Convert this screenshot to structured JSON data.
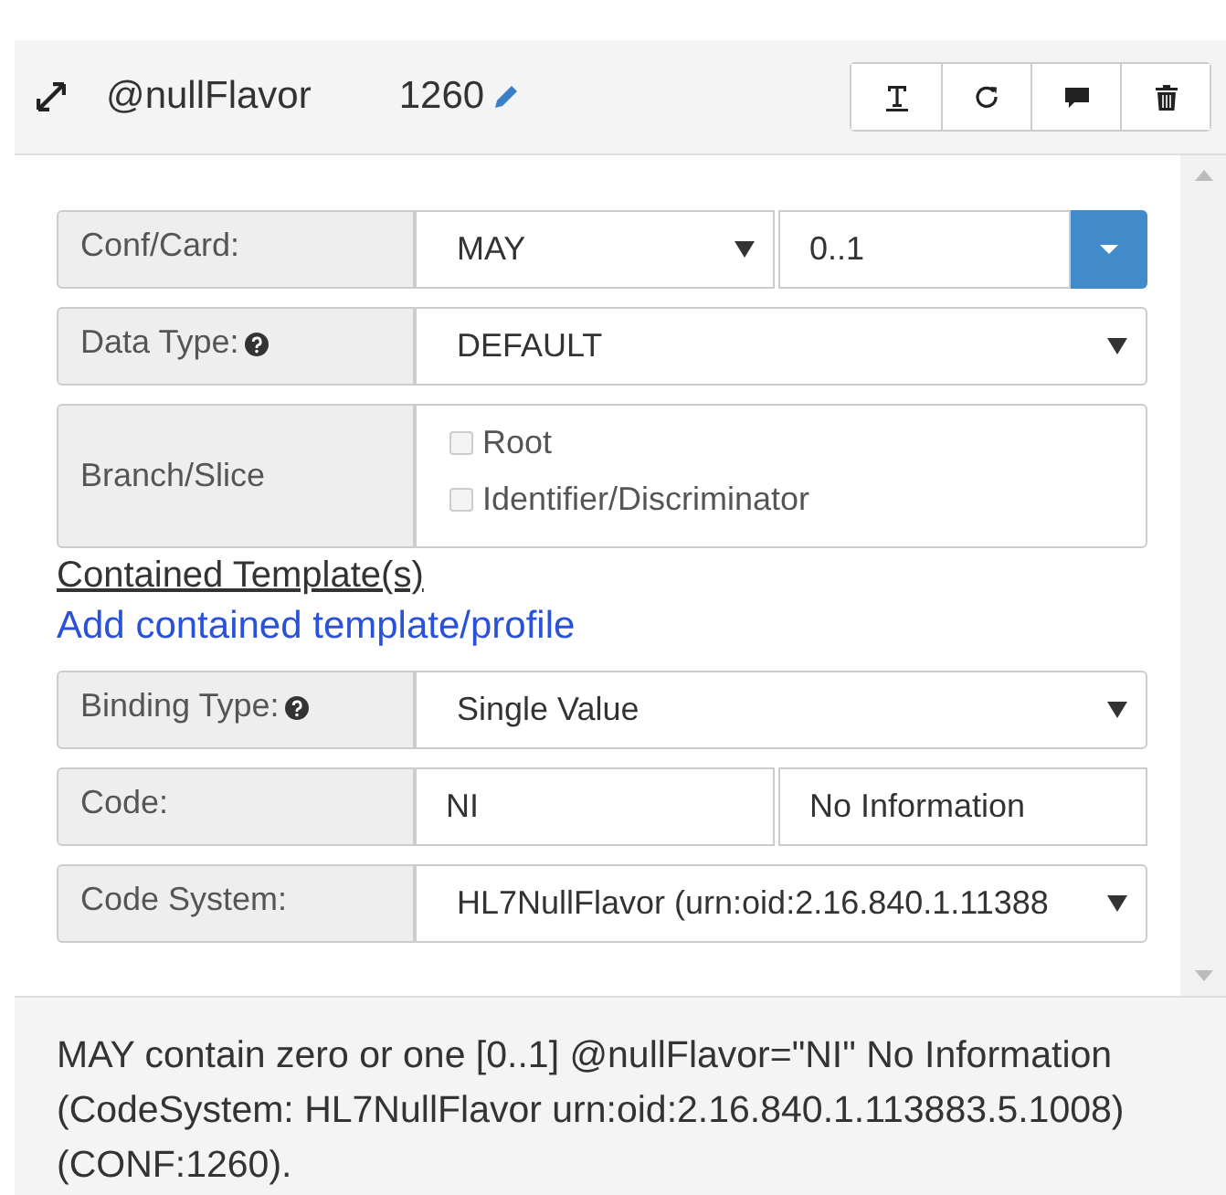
{
  "header": {
    "name": "@nullFlavor",
    "number": "1260"
  },
  "toolbar": [
    {
      "kind": "text"
    },
    {
      "kind": "refresh"
    },
    {
      "kind": "comment"
    },
    {
      "kind": "delete"
    }
  ],
  "fields_top": [
    {
      "kind": "conf",
      "label": "Conf/Card:",
      "value": "MAY",
      "card": "0..1"
    },
    {
      "kind": "select",
      "label": "Data Type:",
      "help": true,
      "value": "DEFAULT"
    },
    {
      "kind": "checks",
      "label": "Branch/Slice",
      "options": [
        {
          "label": "Root",
          "checked": false,
          "disabled": true
        },
        {
          "label": "Identifier/Discriminator",
          "checked": false,
          "disabled": true
        }
      ]
    }
  ],
  "contained": {
    "heading": "Contained Template(s)",
    "link": "Add contained template/profile"
  },
  "fields_bottom": [
    {
      "kind": "select",
      "label": "Binding Type:",
      "help": true,
      "value": "Single Value"
    },
    {
      "kind": "pair",
      "label": "Code:",
      "value": "NI",
      "value_2": "No Information"
    },
    {
      "kind": "select",
      "label": "Code System:",
      "help": false,
      "value": "HL7NullFlavor (urn:oid:2.16.840.1.11388"
    }
  ],
  "description": "MAY contain zero or one [0..1] @nullFlavor=\"NI\" No Information (CodeSystem: HL7NullFlavor urn:oid:2.16.840.1.113883.5.1008) (CONF:1260)."
}
